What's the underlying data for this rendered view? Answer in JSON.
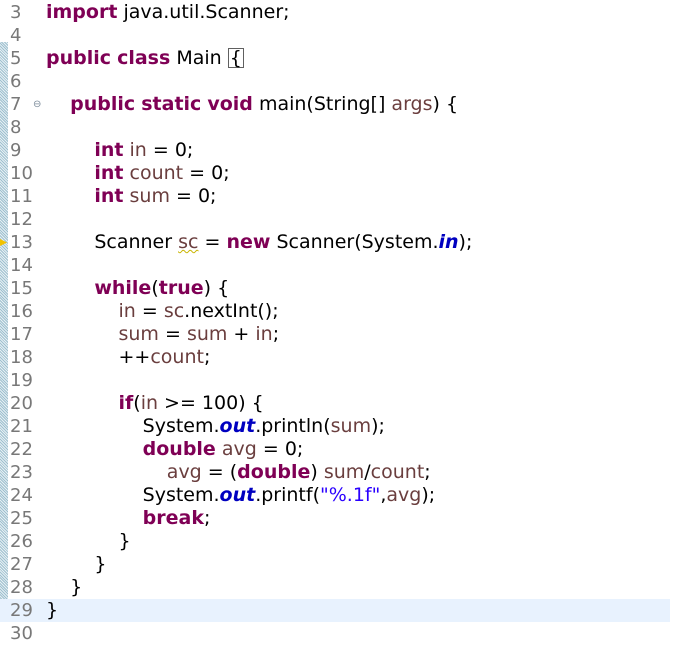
{
  "editor": {
    "language": "java",
    "current_line": "29",
    "lines": [
      {
        "n": "3",
        "text": "import java.util.Scanner;"
      },
      {
        "n": "4",
        "text": ""
      },
      {
        "n": "5",
        "text": "public class Main {"
      },
      {
        "n": "6",
        "text": ""
      },
      {
        "n": "7",
        "text": "    public static void main(String[] args) {"
      },
      {
        "n": "8",
        "text": ""
      },
      {
        "n": "9",
        "text": "        int in = 0;"
      },
      {
        "n": "10",
        "text": "        int count = 0;"
      },
      {
        "n": "11",
        "text": "        int sum = 0;"
      },
      {
        "n": "12",
        "text": ""
      },
      {
        "n": "13",
        "text": "        Scanner sc = new Scanner(System.in);"
      },
      {
        "n": "14",
        "text": ""
      },
      {
        "n": "15",
        "text": "        while(true) {"
      },
      {
        "n": "16",
        "text": "            in = sc.nextInt();"
      },
      {
        "n": "17",
        "text": "            sum = sum + in;"
      },
      {
        "n": "18",
        "text": "            ++count;"
      },
      {
        "n": "19",
        "text": ""
      },
      {
        "n": "20",
        "text": "            if(in >= 100) {"
      },
      {
        "n": "21",
        "text": "                System.out.println(sum);"
      },
      {
        "n": "22",
        "text": "                double avg = 0;"
      },
      {
        "n": "23",
        "text": "                    avg = (double) sum/count;"
      },
      {
        "n": "24",
        "text": "                System.out.printf(\"%.1f\",avg);"
      },
      {
        "n": "25",
        "text": "                break;"
      },
      {
        "n": "26",
        "text": "            }"
      },
      {
        "n": "27",
        "text": "        }"
      },
      {
        "n": "28",
        "text": "    }"
      },
      {
        "n": "29",
        "text": "}"
      },
      {
        "n": "30",
        "text": ""
      }
    ]
  },
  "colors": {
    "keyword": "#7f0055",
    "variable": "#6a3e3e",
    "string": "#2a00ff",
    "static_field": "#0000c0",
    "line_number": "#787878",
    "current_line_bg": "#e8f2fe"
  },
  "icons": {
    "fold": "collapse-minus-icon",
    "warning": "warning-marker-icon"
  }
}
